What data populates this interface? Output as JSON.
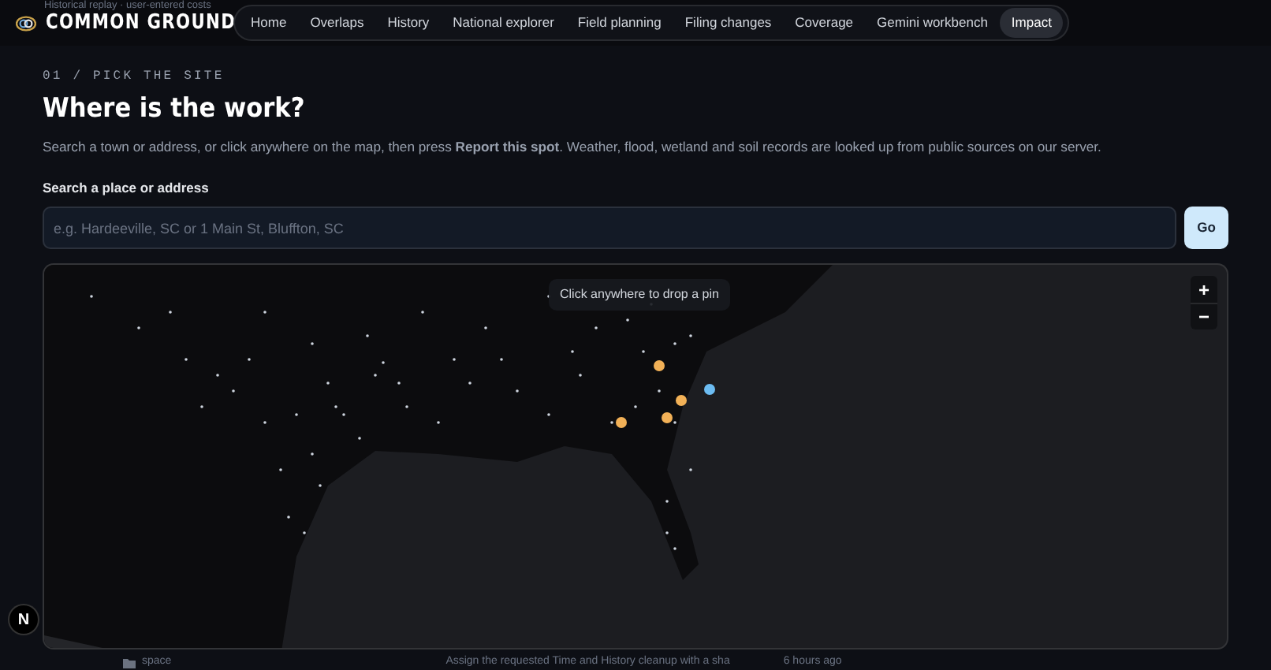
{
  "background_note": "Historical replay · user-entered costs",
  "brand": {
    "name": "COMMON GROUND"
  },
  "nav": [
    {
      "label": "Home",
      "selected": false
    },
    {
      "label": "Overlaps",
      "selected": false
    },
    {
      "label": "History",
      "selected": false
    },
    {
      "label": "National explorer",
      "selected": false
    },
    {
      "label": "Field planning",
      "selected": false
    },
    {
      "label": "Filing changes",
      "selected": false
    },
    {
      "label": "Coverage",
      "selected": false
    },
    {
      "label": "Gemini workbench",
      "selected": false
    },
    {
      "label": "Impact",
      "selected": true
    }
  ],
  "step": {
    "eyebrow": "01 / PICK THE SITE",
    "title": "Where is the work?",
    "description": "Search a town or address, or click anywhere on the map, then press **Report this spot**. Weather, flood, wetland and soil records are looked up from public sources on our server."
  },
  "search": {
    "label": "Search a place or address",
    "placeholder": "e.g. Hardeeville, SC or 1 Main St, Bluffton, SC",
    "button": "Go"
  },
  "map": {
    "hint": "Click anywhere to drop a pin",
    "zoom_in": "+",
    "zoom_out": "−"
  },
  "dev_badge": "N",
  "below": {
    "folder": "space",
    "message": "Assign the requested Time and History cleanup with a sha",
    "time": "6 hours ago"
  }
}
